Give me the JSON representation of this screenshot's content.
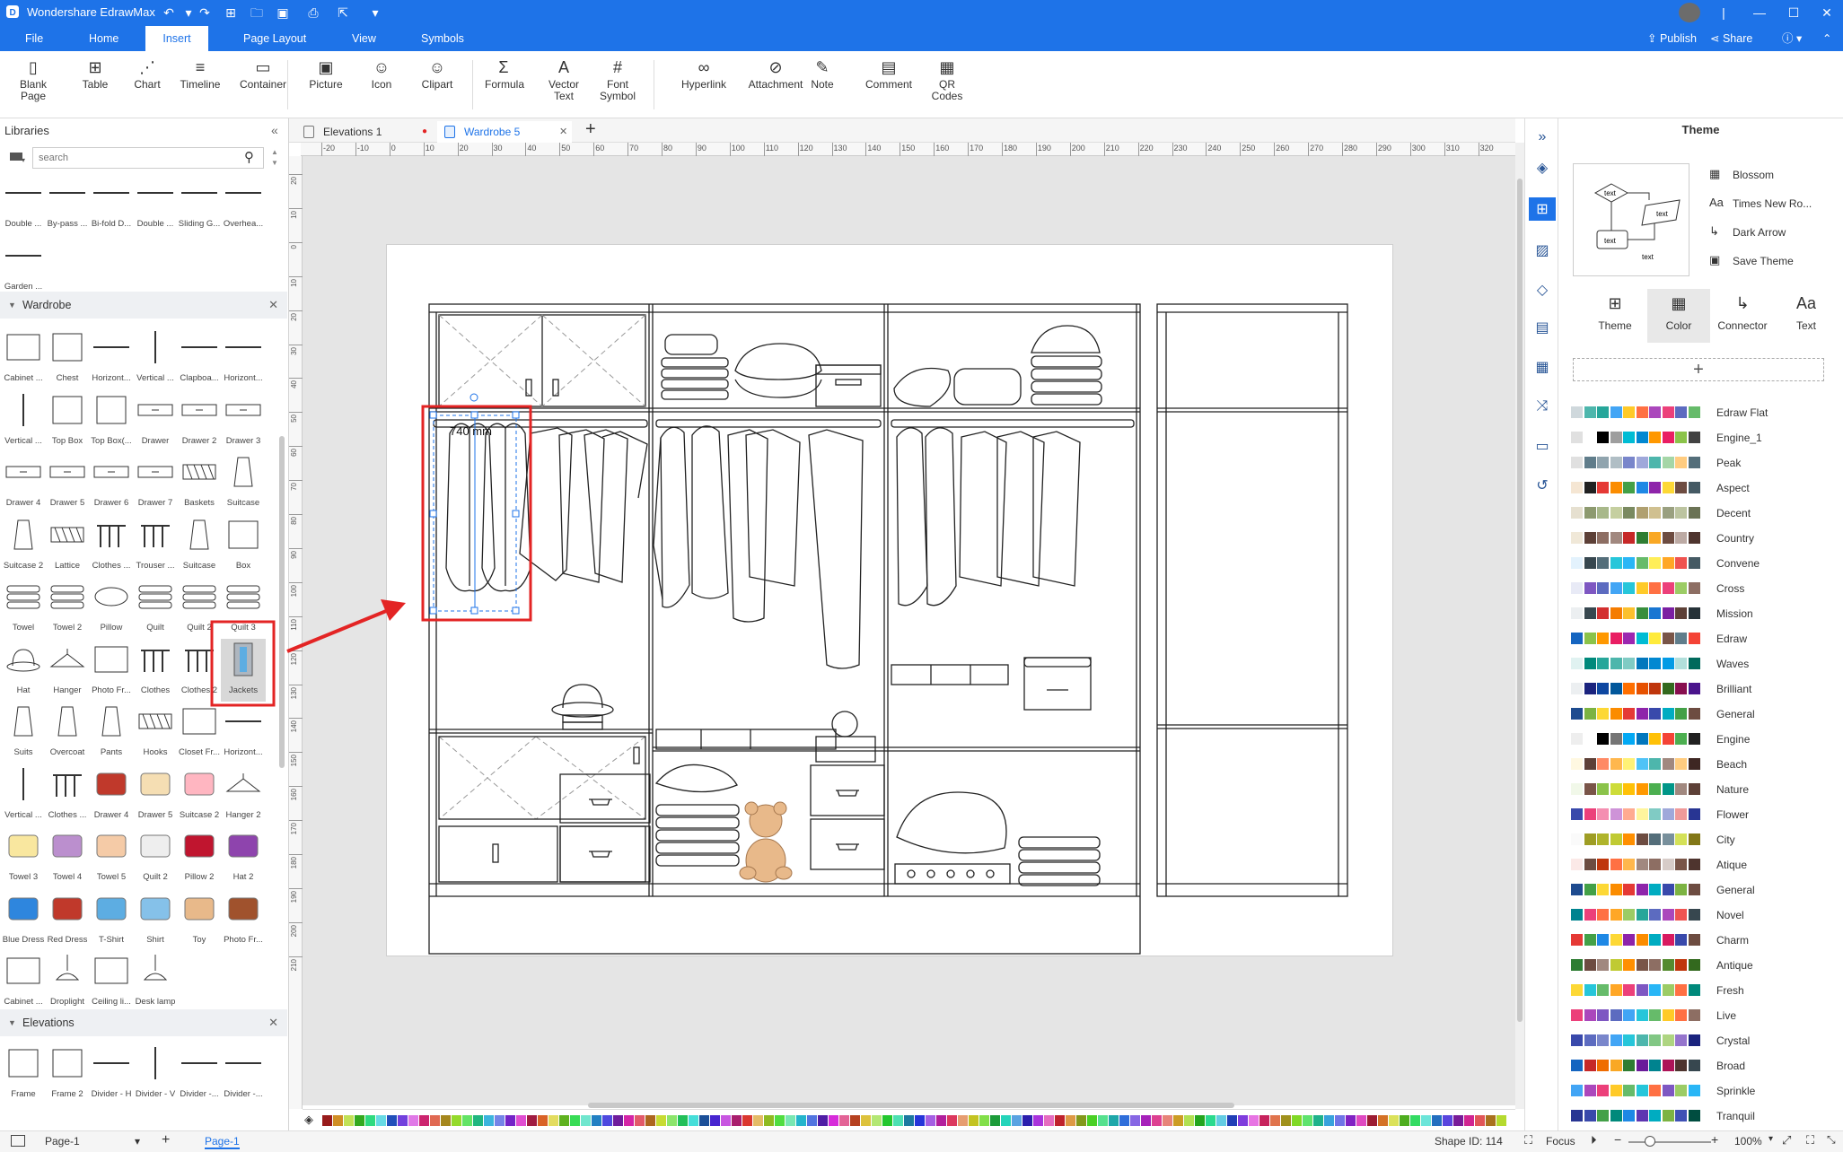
{
  "app": {
    "title": "Wondershare EdrawMax",
    "publish": "Publish",
    "share": "Share"
  },
  "menu": {
    "tabs": [
      "File",
      "Home",
      "Insert",
      "Page Layout",
      "View",
      "Symbols"
    ],
    "active_index": 2
  },
  "ribbon": {
    "items": [
      {
        "label": "Blank Page",
        "icon": "blank-page-icon"
      },
      {
        "label": "Table",
        "icon": "table-icon"
      },
      {
        "label": "Chart",
        "icon": "chart-icon"
      },
      {
        "label": "Timeline",
        "icon": "timeline-icon"
      },
      {
        "label": "Container",
        "icon": "container-icon"
      },
      {
        "label": "Picture",
        "icon": "picture-icon"
      },
      {
        "label": "Icon",
        "icon": "icon-icon"
      },
      {
        "label": "Clipart",
        "icon": "clipart-icon"
      },
      {
        "label": "Formula",
        "icon": "formula-icon"
      },
      {
        "label": "Vector Text",
        "icon": "vector-text-icon"
      },
      {
        "label": "Font Symbol",
        "icon": "font-symbol-icon"
      },
      {
        "label": "Hyperlink",
        "icon": "hyperlink-icon"
      },
      {
        "label": "Attachment",
        "icon": "attachment-icon"
      },
      {
        "label": "Note",
        "icon": "note-icon"
      },
      {
        "label": "Comment",
        "icon": "comment-icon"
      },
      {
        "label": "QR Codes",
        "icon": "qr-code-icon"
      }
    ]
  },
  "libraries": {
    "title": "Libraries",
    "search_placeholder": "search",
    "top_shapes": [
      "Double ...",
      "By-pass ...",
      "Bi-fold D...",
      "Double ...",
      "Sliding G...",
      "Overhea...",
      "Garden ..."
    ],
    "wardrobe": {
      "title": "Wardrobe",
      "shapes": [
        "Cabinet ...",
        "Chest",
        "Horizont...",
        "Vertical ...",
        "Clapboa...",
        "Horizont...",
        "Vertical ...",
        "Top Box",
        "Top Box(...",
        "Drawer",
        "Drawer 2",
        "Drawer 3",
        "Drawer 4",
        "Drawer 5",
        "Drawer 6",
        "Drawer 7",
        "Baskets",
        "Suitcase",
        "Suitcase 2",
        "Lattice",
        "Clothes ...",
        "Trouser ...",
        "Suitcase",
        "Box",
        "Towel",
        "Towel 2",
        "Pillow",
        "Quilt",
        "Quilt 2",
        "Quilt 3",
        "Hat",
        "Hanger",
        "Photo Fr...",
        "Clothes",
        "Clothes 2",
        "Jackets",
        "Suits",
        "Overcoat",
        "Pants",
        "Hooks",
        "Closet Fr...",
        "Horizont...",
        "Vertical ...",
        "Clothes ...",
        "Drawer 4",
        "Drawer 5",
        "Suitcase 2",
        "Hanger 2",
        "Towel 3",
        "Towel 4",
        "Towel 5",
        "Quilt 2",
        "Pillow 2",
        "Hat 2",
        "Blue Dress",
        "Red Dress",
        "T-Shirt",
        "Shirt",
        "Toy",
        "Photo Fr...",
        "Cabinet ...",
        "Droplight",
        "Ceiling li...",
        "Desk lamp"
      ]
    },
    "elevations": {
      "title": "Elevations",
      "shapes": [
        "Frame",
        "Frame 2",
        "Divider - H",
        "Divider - V",
        "Divider -...",
        "Divider -..."
      ]
    }
  },
  "doc_tabs": [
    {
      "label": "Elevations 1",
      "modified": true
    },
    {
      "label": "Wardrobe 5",
      "active": true
    }
  ],
  "ruler": {
    "h": [
      "-20",
      "-10",
      "0",
      "10",
      "20",
      "30",
      "40",
      "50",
      "60",
      "70",
      "80",
      "90",
      "100",
      "110",
      "120",
      "130",
      "140",
      "150",
      "160",
      "170",
      "180",
      "190",
      "200",
      "210",
      "220",
      "230",
      "240",
      "250",
      "260",
      "270",
      "280",
      "290",
      "300",
      "310",
      "320"
    ],
    "v": [
      "20",
      "10",
      "0",
      "10",
      "20",
      "30",
      "40",
      "50",
      "60",
      "70",
      "80",
      "90",
      "100",
      "110",
      "120",
      "130",
      "140",
      "150",
      "160",
      "170",
      "180",
      "190",
      "200",
      "210"
    ]
  },
  "canvas": {
    "dimension_label": "740 mm"
  },
  "theme_panel": {
    "title": "Theme",
    "options": [
      "Blossom",
      "Times New Ro...",
      "Dark Arrow",
      "Save Theme"
    ],
    "tabs": [
      "Theme",
      "Color",
      "Connector",
      "Text"
    ],
    "active_tab": 1,
    "preview_labels": [
      "text",
      "text",
      "text",
      "text"
    ],
    "themes": [
      {
        "name": "Edraw Flat",
        "colors": [
          "#cfd8dc",
          "#4db6ac",
          "#26a69a",
          "#42a5f5",
          "#ffca28",
          "#ff7043",
          "#ab47bc",
          "#ec407a",
          "#5c6bc0",
          "#66bb6a"
        ]
      },
      {
        "name": "Engine_1",
        "colors": [
          "#e0e0e0",
          "#ffffff",
          "#000000",
          "#9e9e9e",
          "#00bcd4",
          "#0288d1",
          "#ff9800",
          "#e91e63",
          "#8bc34a",
          "#424242"
        ]
      },
      {
        "name": "Peak",
        "colors": [
          "#e0e0e0",
          "#607d8b",
          "#90a4ae",
          "#b0bec5",
          "#7986cb",
          "#9fa8da",
          "#4db6ac",
          "#a5d6a7",
          "#ffcc80",
          "#546e7a"
        ]
      },
      {
        "name": "Aspect",
        "colors": [
          "#f5e6d3",
          "#212121",
          "#e53935",
          "#fb8c00",
          "#43a047",
          "#1e88e5",
          "#8e24aa",
          "#fdd835",
          "#6d4c41",
          "#455a64"
        ]
      },
      {
        "name": "Decent",
        "colors": [
          "#e6e0d0",
          "#8d9a6f",
          "#a8b88a",
          "#c5cfa0",
          "#7a8a60",
          "#b0a070",
          "#d0c090",
          "#9aa080",
          "#bcc4a0",
          "#6b7355"
        ]
      },
      {
        "name": "Country",
        "colors": [
          "#f0e8d8",
          "#5d4037",
          "#8d6e63",
          "#a1887f",
          "#c62828",
          "#2e7d32",
          "#f9a825",
          "#6d4c41",
          "#bcaaa4",
          "#4e342e"
        ]
      },
      {
        "name": "Convene",
        "colors": [
          "#e3f2fd",
          "#37474f",
          "#546e7a",
          "#26c6da",
          "#29b6f6",
          "#66bb6a",
          "#ffee58",
          "#ffa726",
          "#ef5350",
          "#455a64"
        ]
      },
      {
        "name": "Cross",
        "colors": [
          "#e8eaf6",
          "#7e57c2",
          "#5c6bc0",
          "#42a5f5",
          "#26c6da",
          "#ffca28",
          "#ff7043",
          "#ec407a",
          "#9ccc65",
          "#8d6e63"
        ]
      },
      {
        "name": "Mission",
        "colors": [
          "#eceff1",
          "#37474f",
          "#d32f2f",
          "#f57c00",
          "#fbc02d",
          "#388e3c",
          "#1976d2",
          "#7b1fa2",
          "#5d4037",
          "#263238"
        ]
      },
      {
        "name": "Edraw",
        "colors": [
          "#1565c0",
          "#8bc34a",
          "#ff9800",
          "#e91e63",
          "#9c27b0",
          "#00bcd4",
          "#ffeb3b",
          "#795548",
          "#607d8b",
          "#f44336"
        ]
      },
      {
        "name": "Waves",
        "colors": [
          "#e0f2f1",
          "#00897b",
          "#26a69a",
          "#4db6ac",
          "#80cbc4",
          "#0277bd",
          "#0288d1",
          "#039be5",
          "#b2dfdb",
          "#00695c"
        ]
      },
      {
        "name": "Brilliant",
        "colors": [
          "#eceff1",
          "#1a237e",
          "#0d47a1",
          "#01579b",
          "#ff6f00",
          "#e65100",
          "#bf360c",
          "#33691e",
          "#880e4f",
          "#4a148c"
        ]
      },
      {
        "name": "General",
        "colors": [
          "#1e4b8f",
          "#7cb342",
          "#fdd835",
          "#fb8c00",
          "#e53935",
          "#8e24aa",
          "#3949ab",
          "#00acc1",
          "#43a047",
          "#6d4c41"
        ]
      },
      {
        "name": "Engine",
        "colors": [
          "#eeeeee",
          "#ffffff",
          "#000000",
          "#757575",
          "#03a9f4",
          "#0277bd",
          "#ffc107",
          "#f44336",
          "#4caf50",
          "#212121"
        ]
      },
      {
        "name": "Beach",
        "colors": [
          "#fff8e1",
          "#5d4037",
          "#ff8a65",
          "#ffb74d",
          "#fff176",
          "#4fc3f7",
          "#4db6ac",
          "#a1887f",
          "#ffcc80",
          "#3e2723"
        ]
      },
      {
        "name": "Nature",
        "colors": [
          "#f1f8e9",
          "#795548",
          "#8bc34a",
          "#cddc39",
          "#ffc107",
          "#ff9800",
          "#4caf50",
          "#009688",
          "#a1887f",
          "#5d4037"
        ]
      },
      {
        "name": "Flower",
        "colors": [
          "#3949ab",
          "#ec407a",
          "#f48fb1",
          "#ce93d8",
          "#ffab91",
          "#fff59d",
          "#80cbc4",
          "#9fa8da",
          "#ef9a9a",
          "#283593"
        ]
      },
      {
        "name": "City",
        "colors": [
          "#fafafa",
          "#9e9d24",
          "#afb42b",
          "#c0ca33",
          "#ff8f00",
          "#6d4c41",
          "#546e7a",
          "#78909c",
          "#d4e157",
          "#827717"
        ]
      },
      {
        "name": "Atique",
        "colors": [
          "#fbe9e7",
          "#6d4c41",
          "#bf360c",
          "#ff7043",
          "#ffb74d",
          "#a1887f",
          "#8d6e63",
          "#d7ccc8",
          "#795548",
          "#4e342e"
        ]
      },
      {
        "name": "General",
        "colors": [
          "#1e4b8f",
          "#43a047",
          "#fdd835",
          "#fb8c00",
          "#e53935",
          "#8e24aa",
          "#00acc1",
          "#3949ab",
          "#7cb342",
          "#6d4c41"
        ]
      },
      {
        "name": "Novel",
        "colors": [
          "#00838f",
          "#ec407a",
          "#ff7043",
          "#ffa726",
          "#9ccc65",
          "#26a69a",
          "#5c6bc0",
          "#ab47bc",
          "#ef5350",
          "#37474f"
        ]
      },
      {
        "name": "Charm",
        "colors": [
          "#e53935",
          "#43a047",
          "#1e88e5",
          "#fdd835",
          "#8e24aa",
          "#fb8c00",
          "#00acc1",
          "#d81b60",
          "#3949ab",
          "#6d4c41"
        ]
      },
      {
        "name": "Antique",
        "colors": [
          "#2e7d32",
          "#6d4c41",
          "#a1887f",
          "#c0ca33",
          "#ff8f00",
          "#795548",
          "#8d6e63",
          "#558b2f",
          "#bf360c",
          "#33691e"
        ]
      },
      {
        "name": "Fresh",
        "colors": [
          "#fdd835",
          "#26c6da",
          "#66bb6a",
          "#ffa726",
          "#ec407a",
          "#7e57c2",
          "#29b6f6",
          "#9ccc65",
          "#ff7043",
          "#00897b"
        ]
      },
      {
        "name": "Live",
        "colors": [
          "#ec407a",
          "#ab47bc",
          "#7e57c2",
          "#5c6bc0",
          "#42a5f5",
          "#26c6da",
          "#66bb6a",
          "#ffca28",
          "#ff7043",
          "#8d6e63"
        ]
      },
      {
        "name": "Crystal",
        "colors": [
          "#3949ab",
          "#5c6bc0",
          "#7986cb",
          "#42a5f5",
          "#26c6da",
          "#4db6ac",
          "#81c784",
          "#aed581",
          "#9575cd",
          "#1a237e"
        ]
      },
      {
        "name": "Broad",
        "colors": [
          "#1565c0",
          "#c62828",
          "#ef6c00",
          "#f9a825",
          "#2e7d32",
          "#6a1b9a",
          "#00838f",
          "#ad1457",
          "#4e342e",
          "#37474f"
        ]
      },
      {
        "name": "Sprinkle",
        "colors": [
          "#42a5f5",
          "#ab47bc",
          "#ec407a",
          "#ffca28",
          "#66bb6a",
          "#26c6da",
          "#ff7043",
          "#7e57c2",
          "#9ccc65",
          "#29b6f6"
        ]
      },
      {
        "name": "Tranquil",
        "colors": [
          "#283593",
          "#3949ab",
          "#43a047",
          "#00897b",
          "#1e88e5",
          "#5e35b1",
          "#00acc1",
          "#7cb342",
          "#3f51b5",
          "#004d40"
        ]
      }
    ]
  },
  "status": {
    "page_tab": "Page-1",
    "page_label": "Page-1",
    "shape_id": "Shape ID: 114",
    "focus": "Focus",
    "zoom": "100%"
  },
  "colors": {
    "brand": "#1e73e8",
    "accent_red": "#e32424"
  }
}
